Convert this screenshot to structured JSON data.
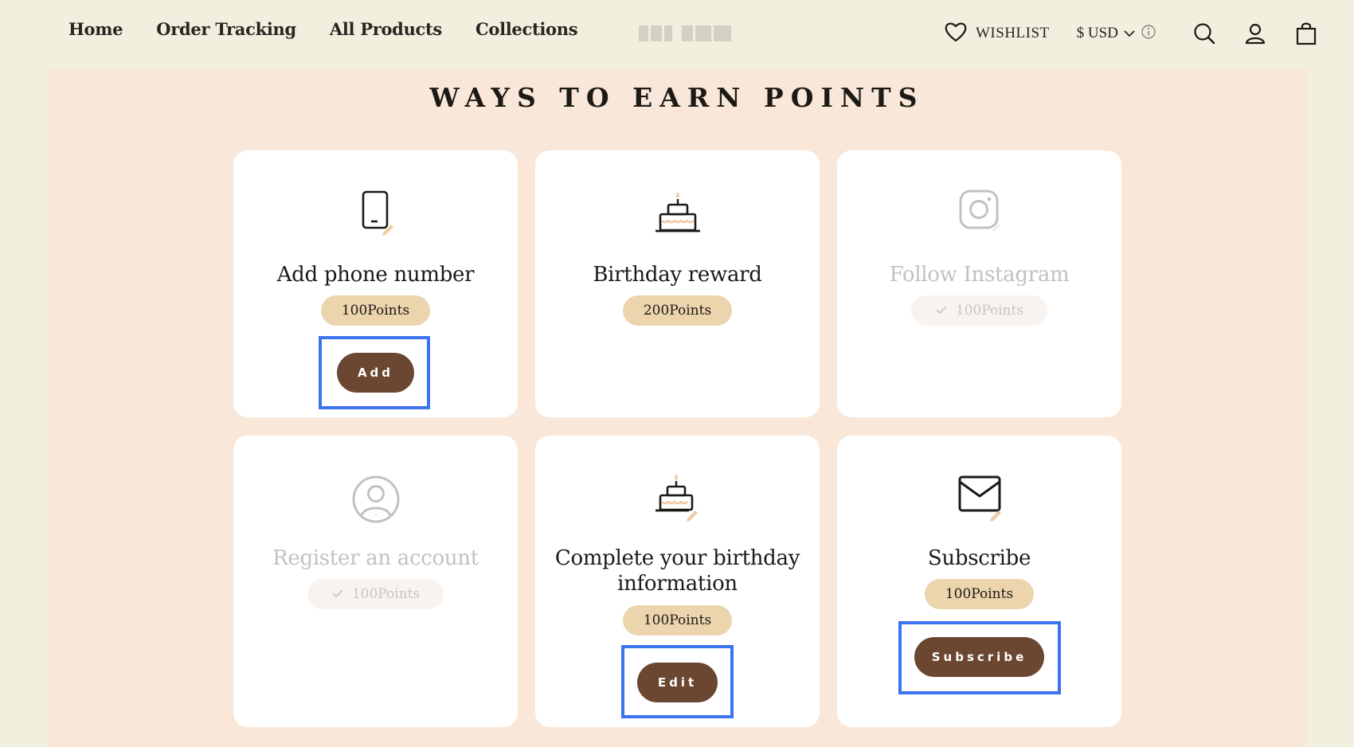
{
  "nav": {
    "items": [
      {
        "label": "Home"
      },
      {
        "label": "Order Tracking"
      },
      {
        "label": "All Products"
      },
      {
        "label": "Collections"
      }
    ]
  },
  "header": {
    "wishlist_label": "WISHLIST",
    "currency_label": "$ USD",
    "icons": [
      "heart-icon",
      "chevron-down-icon",
      "info-icon",
      "search-icon",
      "account-icon",
      "cart-icon"
    ]
  },
  "section": {
    "title": "WAYS TO EARN POINTS"
  },
  "cards": [
    {
      "title": "Add phone number",
      "points": "100Points",
      "button": "Add",
      "completed": false,
      "icon": "phone-edit-icon"
    },
    {
      "title": "Birthday reward",
      "points": "200Points",
      "button": "",
      "completed": false,
      "icon": "birthday-cake-icon"
    },
    {
      "title": "Follow Instagram",
      "points": "100Points",
      "button": "",
      "completed": true,
      "icon": "instagram-icon"
    },
    {
      "title": "Register an account",
      "points": "100Points",
      "button": "",
      "completed": true,
      "icon": "user-circle-icon"
    },
    {
      "title": "Complete your birthday information",
      "points": "100Points",
      "button": "Edit",
      "completed": false,
      "icon": "birthday-cake-edit-icon"
    },
    {
      "title": "Subscribe",
      "points": "100Points",
      "button": "Subscribe",
      "completed": false,
      "icon": "envelope-edit-icon"
    }
  ],
  "colors": {
    "page_bg": "#f1efdd",
    "panel_bg": "#f9e8d9",
    "pill_bg": "#ecd4ad",
    "button_bg": "#6b4731",
    "highlight": "#3c73f0"
  }
}
